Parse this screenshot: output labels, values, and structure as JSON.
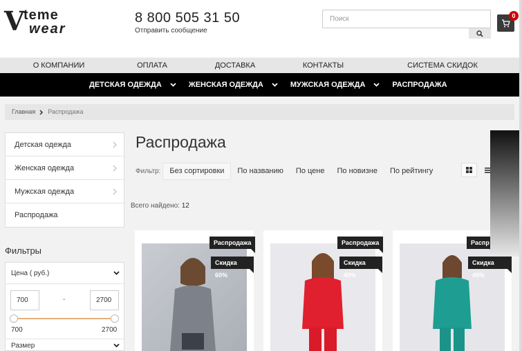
{
  "header": {
    "logo_line1": "teme",
    "logo_line2": "wear",
    "phone": "8 800 505 31 50",
    "send_message": "Отправить сообщение",
    "search_placeholder": "Поиск",
    "cart_count": "0"
  },
  "nav_top": [
    "О КОМПАНИИ",
    "ОПЛАТА",
    "ДОСТАВКА",
    "КОНТАКТЫ",
    "СИСТЕМА СКИДОК"
  ],
  "nav_main": [
    "ДЕТСКАЯ ОДЕЖДА",
    "ЖЕНСКАЯ ОДЕЖДА",
    "МУЖСКАЯ ОДЕЖДА",
    "РАСПРОДАЖА"
  ],
  "breadcrumb": {
    "home": "Главная",
    "current": "Распродажа"
  },
  "sidebar": {
    "categories": [
      "Детская одежда",
      "Женская одежда",
      "Мужская одежда",
      "Распродажа"
    ],
    "filters_title": "Фильтры",
    "price_label": "Цена ( руб.)",
    "price_min": "700",
    "price_max": "2700",
    "range_min": "700",
    "range_max": "2700",
    "dash": "-",
    "size_label": "Размер"
  },
  "main": {
    "title": "Распродажа",
    "filter_label": "Фильтр:",
    "sort_options": [
      "Без сортировки",
      "По названию",
      "По цене",
      "По новизне",
      "По рейтингу"
    ],
    "found_label": "Всего найдено:",
    "found_count": "12"
  },
  "products": [
    {
      "sale_tag": "Распродажа",
      "discount_tag": "Скидка 60%",
      "color": "#8a8f97"
    },
    {
      "sale_tag": "Распродажа",
      "discount_tag": "Скидка 40%",
      "color": "#e0202f"
    },
    {
      "sale_tag": "Распр",
      "discount_tag": "Скидка 45%",
      "color": "#1e9e92"
    }
  ]
}
